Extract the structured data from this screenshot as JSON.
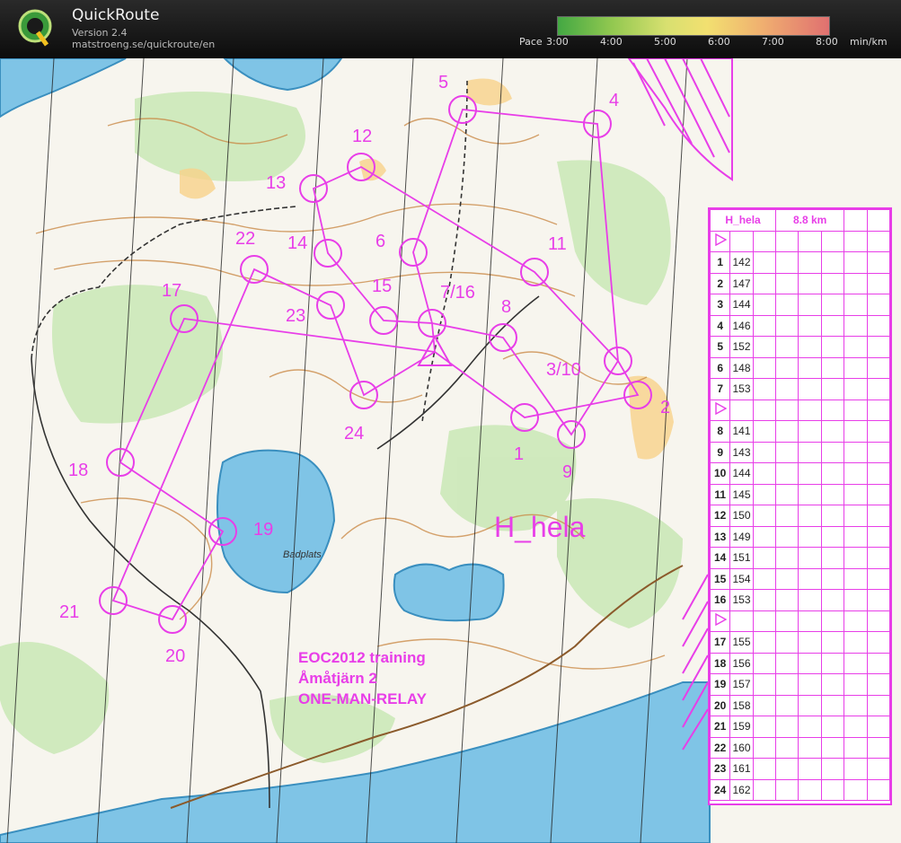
{
  "app": {
    "title": "QuickRoute",
    "version": "Version 2.4",
    "url": "matstroeng.se/quickroute/en"
  },
  "pace_scale": {
    "prefix": "Pace",
    "ticks": [
      "3:00",
      "4:00",
      "5:00",
      "6:00",
      "7:00",
      "8:00"
    ],
    "unit": "min/km",
    "colors": [
      "#43a843",
      "#92c850",
      "#d8e070",
      "#f2e070",
      "#f0b070",
      "#e07070"
    ]
  },
  "map": {
    "course_label": "H_hela",
    "title_lines": [
      "EOC2012 training",
      "Åmåtjärn 2",
      "ONE-MAN-RELAY"
    ],
    "place_name": "Badplats",
    "overprint_color": "#e83ee8",
    "control_labels": [
      "1",
      "2",
      "3/10",
      "4",
      "5",
      "6",
      "7/16",
      "8",
      "9",
      "11",
      "12",
      "13",
      "14",
      "15",
      "17",
      "18",
      "19",
      "20",
      "21",
      "22",
      "23",
      "24"
    ]
  },
  "description_sheet": {
    "course": "H_hela",
    "length": "8.8 km",
    "rows": [
      {
        "num": "",
        "code": "",
        "start": true
      },
      {
        "num": "1",
        "code": "142"
      },
      {
        "num": "2",
        "code": "147"
      },
      {
        "num": "3",
        "code": "144"
      },
      {
        "num": "4",
        "code": "146"
      },
      {
        "num": "5",
        "code": "152"
      },
      {
        "num": "6",
        "code": "148"
      },
      {
        "num": "7",
        "code": "153"
      },
      {
        "num": "",
        "code": "",
        "start": true
      },
      {
        "num": "8",
        "code": "141"
      },
      {
        "num": "9",
        "code": "143"
      },
      {
        "num": "10",
        "code": "144"
      },
      {
        "num": "11",
        "code": "145"
      },
      {
        "num": "12",
        "code": "150"
      },
      {
        "num": "13",
        "code": "149"
      },
      {
        "num": "14",
        "code": "151"
      },
      {
        "num": "15",
        "code": "154"
      },
      {
        "num": "16",
        "code": "153"
      },
      {
        "num": "",
        "code": "",
        "start": true
      },
      {
        "num": "17",
        "code": "155"
      },
      {
        "num": "18",
        "code": "156"
      },
      {
        "num": "19",
        "code": "157"
      },
      {
        "num": "20",
        "code": "158"
      },
      {
        "num": "21",
        "code": "159"
      },
      {
        "num": "22",
        "code": "160"
      },
      {
        "num": "23",
        "code": "161"
      },
      {
        "num": "24",
        "code": "162"
      }
    ]
  }
}
